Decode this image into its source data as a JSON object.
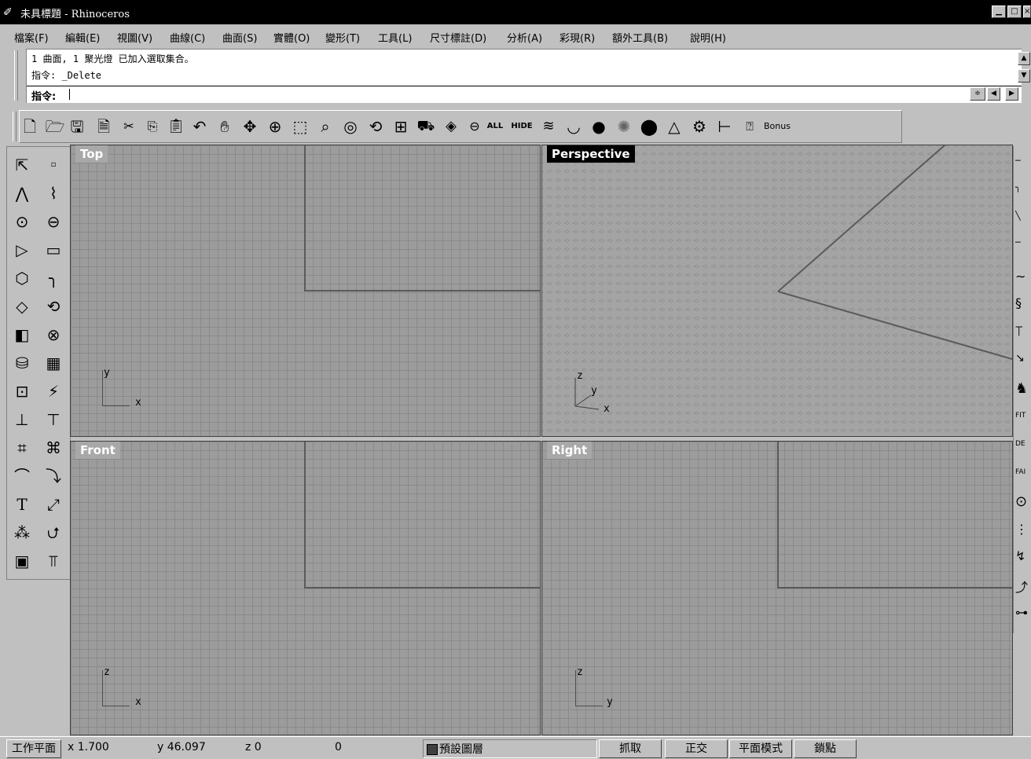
{
  "window": {
    "title": "未具標題 - Rhinoceros",
    "logo": "rhino-icon",
    "buttons": [
      "_",
      "□",
      "×"
    ]
  },
  "menu": [
    {
      "label": "檔案(F)"
    },
    {
      "label": "編輯(E)"
    },
    {
      "label": "視圖(V)"
    },
    {
      "label": "曲線(C)"
    },
    {
      "label": "曲面(S)"
    },
    {
      "label": "實體(O)"
    },
    {
      "label": "變形(T)"
    },
    {
      "label": "工具(L)"
    },
    {
      "label": "尺寸標註(D)"
    },
    {
      "label": "分析(A)"
    },
    {
      "label": "彩現(R)"
    },
    {
      "label": "額外工具(B)"
    },
    {
      "label": "說明(H)"
    }
  ],
  "command": {
    "history": [
      "1 曲面, 1 聚光燈 已加入選取集合。",
      "指令: _Delete"
    ],
    "prompt": "指令:",
    "value": ""
  },
  "toolbar": {
    "all_label": "ALL",
    "hide_label": "HIDE",
    "bonus_label": "Bonus",
    "icons": [
      "new-file-icon",
      "open-folder-icon",
      "save-icon",
      "open-template-icon",
      "cut-icon",
      "copy-icon",
      "paste-icon",
      "undo-icon",
      "pan-hand-icon",
      "rotate-view-icon",
      "zoom-icon",
      "zoom-window-icon",
      "zoom-extents-icon",
      "zoom-selected-icon",
      "zoom-dynamic-icon",
      "four-viewports-icon",
      "car-shade-icon",
      "layers-stack-icon",
      "select-all-icon",
      "hide-icon",
      "layer-icon",
      "rotate-icon",
      "shaded-sphere-icon",
      "render-sphere-icon",
      "black-sphere-icon",
      "light-cone-icon",
      "settings-gear-icon",
      "dimension-icon",
      "help-icon",
      "bonus-icon"
    ]
  },
  "viewports": {
    "top": {
      "title": "Top",
      "axis1": "y",
      "axis2": "x"
    },
    "perspective": {
      "title": "Perspective",
      "axis1": "z",
      "axis2": "y",
      "axis3": "x"
    },
    "front": {
      "title": "Front",
      "axis1": "z",
      "axis2": "x"
    },
    "right": {
      "title": "Right",
      "axis1": "z",
      "axis2": "y"
    }
  },
  "right_toolbar": [
    "FIT",
    "DE",
    "FAI"
  ],
  "status": {
    "plane": "工作平面",
    "x": "x 1.700",
    "y": "y 46.097",
    "z": "z 0",
    "value": "0",
    "layer": "預設圖層",
    "layer_color": "#404040",
    "snap": "抓取",
    "ortho": "正交",
    "planar": "平面模式",
    "osnap": "鎖點"
  }
}
